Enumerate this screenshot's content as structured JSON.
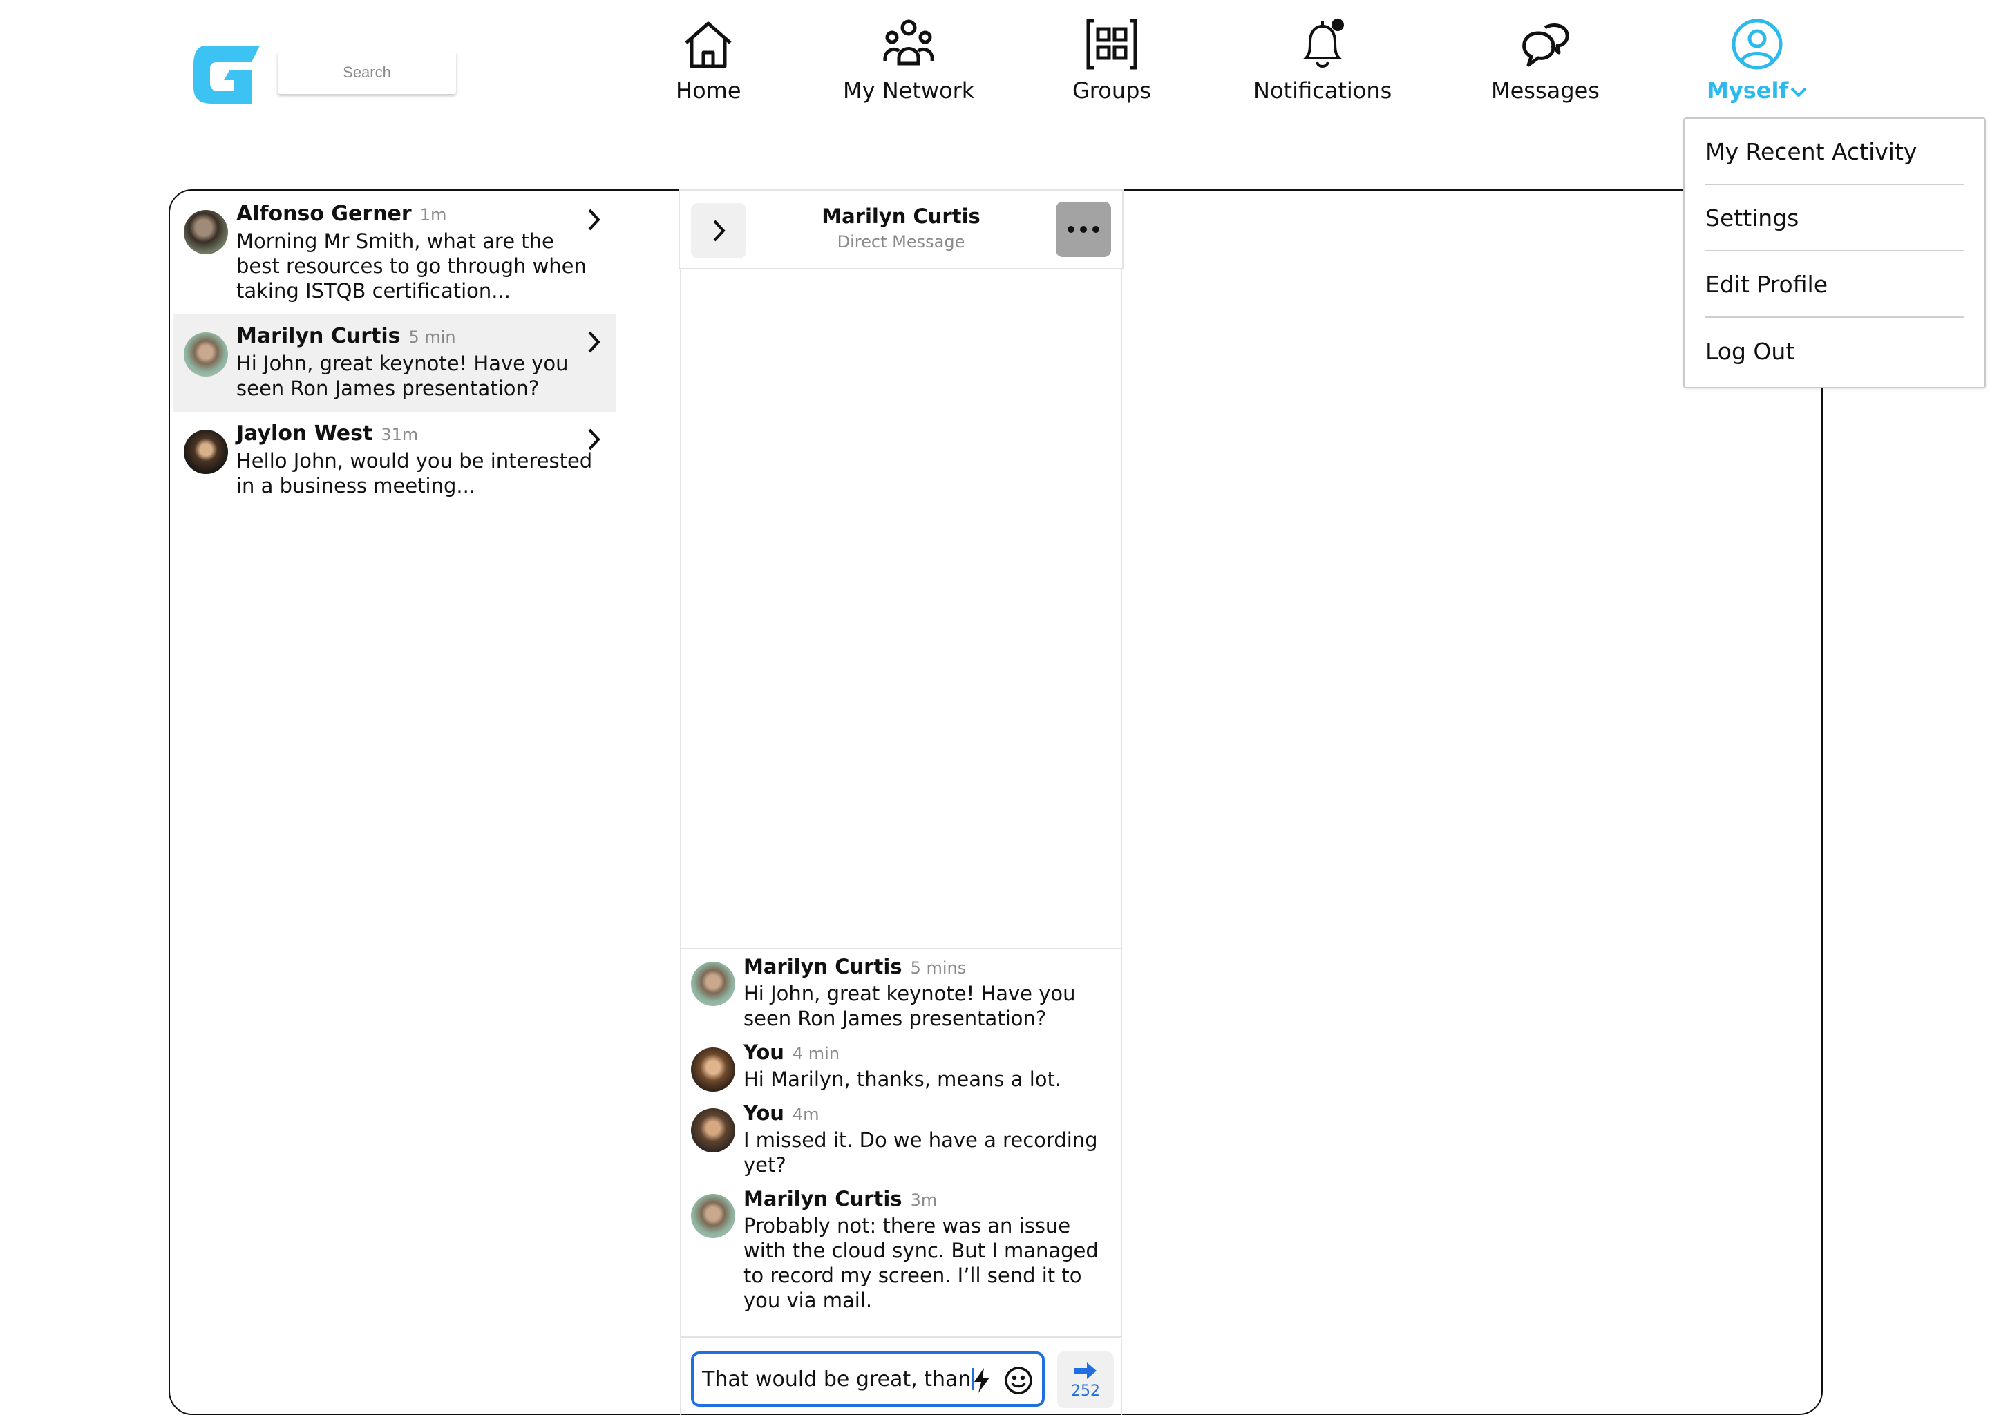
{
  "header": {
    "search_placeholder": "Search",
    "nav": {
      "home": "Home",
      "network": "My Network",
      "groups": "Groups",
      "notifications": "Notifications",
      "messages": "Messages",
      "myself": "Myself"
    },
    "accent_color": "#2cb9ec"
  },
  "dropdown": {
    "items": [
      "My Recent Activity",
      "Settings",
      "Edit Profile",
      "Log Out"
    ]
  },
  "conversations": [
    {
      "name": "Alfonso Gerner",
      "time": "1m",
      "preview": "Morning Mr Smith, what are the best resources to go through when taking ISTQB certification..."
    },
    {
      "name": "Marilyn Curtis",
      "time": "5 min",
      "preview": "Hi John, great keynote! Have you seen Ron James presentation?"
    },
    {
      "name": "Jaylon West",
      "time": "31m",
      "preview": "Hello John, would you be interested in a business meeting..."
    }
  ],
  "chat": {
    "title": "Marilyn Curtis",
    "subtitle": "Direct Message",
    "messages": [
      {
        "name": "Marilyn Curtis",
        "time": "5 mins",
        "text": "Hi John, great keynote! Have you seen Ron James presentation?"
      },
      {
        "name": "You",
        "time": "4 min",
        "text": "Hi Marilyn, thanks, means a lot."
      },
      {
        "name": "You",
        "time": "4m",
        "text": "I missed it. Do we have a recording yet?"
      },
      {
        "name": "Marilyn Curtis",
        "time": "3m",
        "text": "Probably not: there was an issue with the cloud sync. But I managed to record my screen. I’ll send it to you via mail."
      }
    ],
    "compose_value": "That would be great, than",
    "char_count": "252",
    "send_color": "#1f6fe0"
  }
}
